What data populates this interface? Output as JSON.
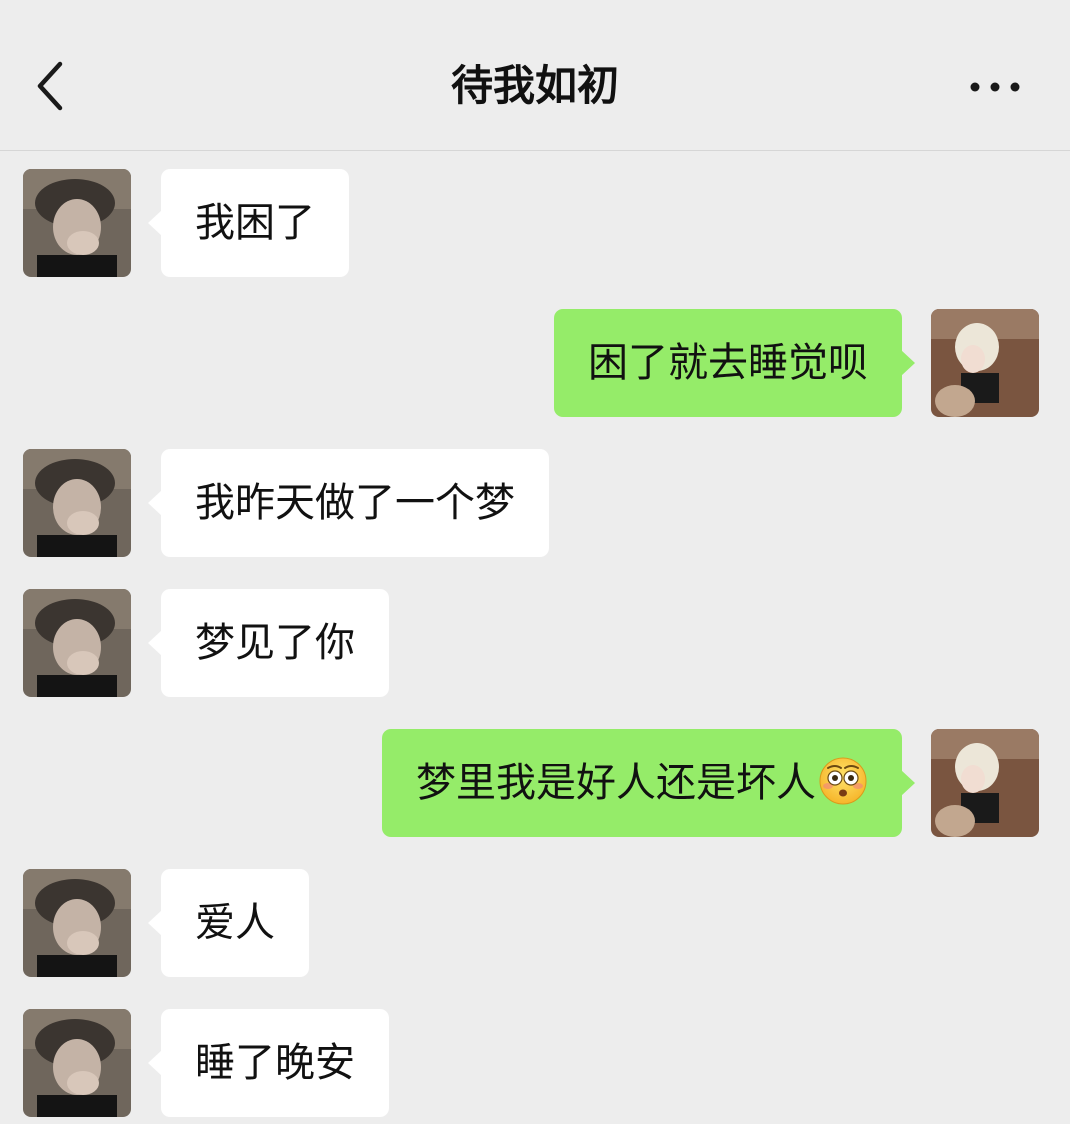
{
  "header": {
    "title": "待我如初",
    "back_icon": "chevron-left-icon",
    "more_icon": "more-dots-icon"
  },
  "colors": {
    "background": "#ededed",
    "incoming_bubble": "#ffffff",
    "outgoing_bubble": "#95ec69"
  },
  "messages": [
    {
      "sender": "other",
      "text": "我困了"
    },
    {
      "sender": "me",
      "text": "困了就去睡觉呗"
    },
    {
      "sender": "other",
      "text": "我昨天做了一个梦"
    },
    {
      "sender": "other",
      "text": "梦见了你"
    },
    {
      "sender": "me",
      "text": "梦里我是好人还是坏人",
      "emoji": "flushed-face-emoji"
    },
    {
      "sender": "other",
      "text": "爱人"
    },
    {
      "sender": "other",
      "text": "睡了晚安"
    }
  ]
}
